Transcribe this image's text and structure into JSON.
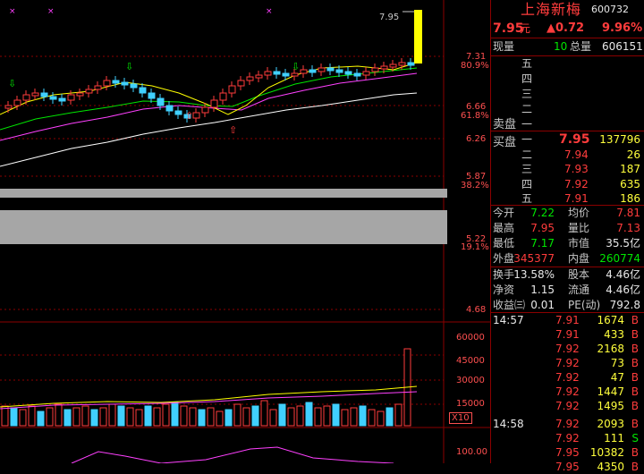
{
  "header": {
    "stock_name": "上海新梅",
    "stock_code": "600732",
    "price": "7.95",
    "price_unit": "元",
    "change": "▲0.72",
    "change_pct": "9.96%"
  },
  "volume_summary": {
    "current_label": "现量",
    "current_value": "10",
    "total_label": "总量",
    "total_value": "606151"
  },
  "sell_book": {
    "title": "卖盘",
    "levels": [
      {
        "label": "五",
        "price": "",
        "qty": ""
      },
      {
        "label": "四",
        "price": "",
        "qty": ""
      },
      {
        "label": "三",
        "price": "",
        "qty": ""
      },
      {
        "label": "二",
        "price": "",
        "qty": ""
      },
      {
        "label": "一",
        "price": "",
        "qty": ""
      }
    ]
  },
  "buy_book": {
    "title": "买盘",
    "levels": [
      {
        "label": "一",
        "price": "7.95",
        "qty": "137796"
      },
      {
        "label": "二",
        "price": "7.94",
        "qty": "26"
      },
      {
        "label": "三",
        "price": "7.93",
        "qty": "187"
      },
      {
        "label": "四",
        "price": "7.92",
        "qty": "635"
      },
      {
        "label": "五",
        "price": "7.91",
        "qty": "186"
      }
    ]
  },
  "stats": [
    [
      {
        "label": "今开",
        "value": "7.22",
        "color": "green"
      },
      {
        "label": "均价",
        "value": "7.81",
        "color": "red"
      }
    ],
    [
      {
        "label": "最高",
        "value": "7.95",
        "color": "red"
      },
      {
        "label": "量比",
        "value": "7.13",
        "color": "red"
      }
    ],
    [
      {
        "label": "最低",
        "value": "7.17",
        "color": "green"
      },
      {
        "label": "市值",
        "value": "35.5亿",
        "color": "white"
      }
    ],
    [
      {
        "label": "外盘",
        "value": "345377",
        "color": "red"
      },
      {
        "label": "内盘",
        "value": "260774",
        "color": "green"
      }
    ]
  ],
  "fundamentals": [
    [
      {
        "label": "换手",
        "value": "13.58%"
      },
      {
        "label": "股本",
        "value": "4.46亿"
      }
    ],
    [
      {
        "label": "净资",
        "value": "1.15"
      },
      {
        "label": "流通",
        "value": "4.46亿"
      }
    ],
    [
      {
        "label": "收益㈢",
        "value": "0.01"
      },
      {
        "label": "PE(动)",
        "value": "792.8"
      }
    ]
  ],
  "ticks": [
    {
      "time": "14:57",
      "price": "7.91",
      "vol": "1674",
      "side": "B"
    },
    {
      "time": "",
      "price": "7.91",
      "vol": "433",
      "side": "B"
    },
    {
      "time": "",
      "price": "7.92",
      "vol": "2168",
      "side": "B"
    },
    {
      "time": "",
      "price": "7.92",
      "vol": "73",
      "side": "B"
    },
    {
      "time": "",
      "price": "7.92",
      "vol": "47",
      "side": "B"
    },
    {
      "time": "",
      "price": "7.92",
      "vol": "1447",
      "side": "B"
    },
    {
      "time": "",
      "price": "7.92",
      "vol": "1495",
      "side": "B"
    },
    {
      "time": "14:58",
      "price": "7.92",
      "vol": "2093",
      "side": "B"
    },
    {
      "time": "",
      "price": "7.92",
      "vol": "111",
      "side": "S"
    },
    {
      "time": "",
      "price": "7.95",
      "vol": "10382",
      "side": "B"
    },
    {
      "time": "",
      "price": "7.95",
      "vol": "4350",
      "side": "B"
    }
  ],
  "chart": {
    "price_axis": [
      "7.31",
      "6.66",
      "6.26",
      "5.87",
      "5.22",
      "4.68"
    ],
    "pct_axis": [
      "80.9%",
      "61.8%",
      "38.2%",
      "19.1%"
    ],
    "last_price_label": "7.95",
    "volume_axis": [
      "60000",
      "45000",
      "30000",
      "15000"
    ],
    "volume_unit": "X10",
    "indicator_label": "100.00"
  },
  "colors": {
    "up": "#ff3c3c",
    "down": "#40d0ff",
    "accent_yellow": "#ffff00",
    "ma_white": "#ffffff",
    "ma_yellow": "#ffff00",
    "ma_magenta": "#ff40ff",
    "ma_green": "#00e600"
  }
}
